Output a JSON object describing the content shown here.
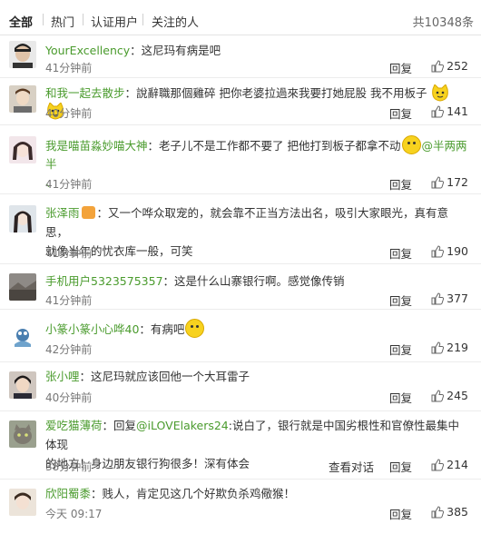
{
  "tabs": {
    "all": "全部",
    "hot": "热门",
    "verified": "认证用户",
    "following": "关注的人",
    "total": "共10348条"
  },
  "colors": {
    "username": "#4a9b2d",
    "accent": "#f7d21f"
  },
  "reply_label": "回复",
  "view_conversation_label": "查看对话",
  "comments": [
    {
      "user": "YourExcellency",
      "text": "：这尼玛有病是吧",
      "time": "41分钟前",
      "likes": "252"
    },
    {
      "user": "和我一起去散步",
      "text": "：說辭職那個雞碎 把你老婆拉過來我要打她屁股 我不用板子",
      "time": "40分钟前",
      "likes": "141"
    },
    {
      "user": "我是喵苗淼妙喵大神",
      "text": "：老子儿不是工作都不要了 把他打到板子都拿不动",
      "mention": "@半两两半",
      "tail": "、",
      "time": "41分钟前",
      "likes": "172"
    },
    {
      "user": "张泽雨",
      "text": "：又一个哗众取宠的，就会靠不正当方法出名，吸引大家眼光，真有意思，",
      "text2": "就像当年的忧衣库一般，可笑",
      "time": "41分钟前",
      "likes": "190"
    },
    {
      "user": "手机用户5323575357",
      "text": "：这是什么山寨银行啊。感觉像传销",
      "time": "41分钟前",
      "likes": "377"
    },
    {
      "user": "小篆小篆小心哗40",
      "text": "：有病吧",
      "time": "42分钟前",
      "likes": "219"
    },
    {
      "user": "张小哩",
      "text": "：这尼玛就应该回他一个大耳雷子",
      "time": "40分钟前",
      "likes": "245"
    },
    {
      "user": "爱吃猫薄荷",
      "pre": "：回复",
      "mention": "@iLOVElakers24",
      "text": ":说白了，银行就是中国劣根性和官僚性最集中体现",
      "text2": "的地方！身边朋友银行狗很多！深有体会",
      "time": "38分钟前",
      "likes": "214"
    },
    {
      "user": "欣阳蜀黍",
      "text": "：贱人，肯定见这几个好欺负杀鸡儆猴！",
      "time": "今天 09:17",
      "likes": "385"
    }
  ]
}
